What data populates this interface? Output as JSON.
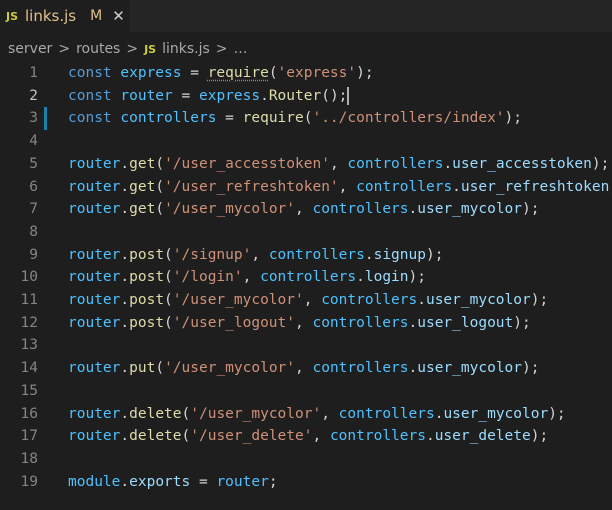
{
  "tab": {
    "icon": "js-file-icon",
    "icon_text": "JS",
    "filename": "links.js",
    "modified": "M",
    "close": "✕"
  },
  "breadcrumb": {
    "folder1": "server",
    "folder2": "routes",
    "file_icon_text": "JS",
    "file": "links.js",
    "more": "…",
    "separator": ">"
  },
  "colors": {
    "background": "#1e1e1e",
    "keyword": "#569cd6",
    "variable": "#4fc1ff",
    "property": "#9cdcfe",
    "function": "#dcdcaa",
    "string": "#ce9178",
    "punct": "#d4d4d4",
    "line_number": "#858585"
  },
  "editor": {
    "active_line": 2,
    "lines": [
      {
        "n": "1",
        "tokens": [
          [
            "const",
            "keyword"
          ],
          [
            " ",
            "punct"
          ],
          [
            "express",
            "variable"
          ],
          [
            " = ",
            "punct"
          ],
          [
            "require",
            "function"
          ],
          [
            "(",
            "punct"
          ],
          [
            "'express'",
            "string"
          ],
          [
            ");",
            "punct"
          ]
        ]
      },
      {
        "n": "2",
        "tokens": [
          [
            "const",
            "keyword"
          ],
          [
            " ",
            "punct"
          ],
          [
            "router",
            "variable"
          ],
          [
            " = ",
            "punct"
          ],
          [
            "express",
            "variable"
          ],
          [
            ".",
            "punct"
          ],
          [
            "Router",
            "function"
          ],
          [
            "();",
            "punct"
          ]
        ]
      },
      {
        "n": "3",
        "tokens": [
          [
            "const",
            "keyword"
          ],
          [
            " ",
            "punct"
          ],
          [
            "controllers",
            "variable"
          ],
          [
            " = ",
            "punct"
          ],
          [
            "require",
            "function"
          ],
          [
            "(",
            "punct"
          ],
          [
            "'../controllers/index'",
            "string"
          ],
          [
            ");",
            "punct"
          ]
        ]
      },
      {
        "n": "4",
        "tokens": []
      },
      {
        "n": "5",
        "tokens": [
          [
            "router",
            "variable"
          ],
          [
            ".",
            "punct"
          ],
          [
            "get",
            "function"
          ],
          [
            "(",
            "punct"
          ],
          [
            "'/user_accesstoken'",
            "string"
          ],
          [
            ", ",
            "punct"
          ],
          [
            "controllers",
            "variable"
          ],
          [
            ".",
            "punct"
          ],
          [
            "user_accesstoken",
            "property"
          ],
          [
            ");",
            "punct"
          ]
        ]
      },
      {
        "n": "6",
        "tokens": [
          [
            "router",
            "variable"
          ],
          [
            ".",
            "punct"
          ],
          [
            "get",
            "function"
          ],
          [
            "(",
            "punct"
          ],
          [
            "'/user_refreshtoken'",
            "string"
          ],
          [
            ", ",
            "punct"
          ],
          [
            "controllers",
            "variable"
          ],
          [
            ".",
            "punct"
          ],
          [
            "user_refreshtoken",
            "property"
          ],
          [
            ");",
            "punct"
          ]
        ]
      },
      {
        "n": "7",
        "tokens": [
          [
            "router",
            "variable"
          ],
          [
            ".",
            "punct"
          ],
          [
            "get",
            "function"
          ],
          [
            "(",
            "punct"
          ],
          [
            "'/user_mycolor'",
            "string"
          ],
          [
            ", ",
            "punct"
          ],
          [
            "controllers",
            "variable"
          ],
          [
            ".",
            "punct"
          ],
          [
            "user_mycolor",
            "property"
          ],
          [
            ");",
            "punct"
          ]
        ]
      },
      {
        "n": "8",
        "tokens": []
      },
      {
        "n": "9",
        "tokens": [
          [
            "router",
            "variable"
          ],
          [
            ".",
            "punct"
          ],
          [
            "post",
            "function"
          ],
          [
            "(",
            "punct"
          ],
          [
            "'/signup'",
            "string"
          ],
          [
            ", ",
            "punct"
          ],
          [
            "controllers",
            "variable"
          ],
          [
            ".",
            "punct"
          ],
          [
            "signup",
            "property"
          ],
          [
            ");",
            "punct"
          ]
        ]
      },
      {
        "n": "10",
        "tokens": [
          [
            "router",
            "variable"
          ],
          [
            ".",
            "punct"
          ],
          [
            "post",
            "function"
          ],
          [
            "(",
            "punct"
          ],
          [
            "'/login'",
            "string"
          ],
          [
            ", ",
            "punct"
          ],
          [
            "controllers",
            "variable"
          ],
          [
            ".",
            "punct"
          ],
          [
            "login",
            "property"
          ],
          [
            ");",
            "punct"
          ]
        ]
      },
      {
        "n": "11",
        "tokens": [
          [
            "router",
            "variable"
          ],
          [
            ".",
            "punct"
          ],
          [
            "post",
            "function"
          ],
          [
            "(",
            "punct"
          ],
          [
            "'/user_mycolor'",
            "string"
          ],
          [
            ", ",
            "punct"
          ],
          [
            "controllers",
            "variable"
          ],
          [
            ".",
            "punct"
          ],
          [
            "user_mycolor",
            "property"
          ],
          [
            ");",
            "punct"
          ]
        ]
      },
      {
        "n": "12",
        "tokens": [
          [
            "router",
            "variable"
          ],
          [
            ".",
            "punct"
          ],
          [
            "post",
            "function"
          ],
          [
            "(",
            "punct"
          ],
          [
            "'/user_logout'",
            "string"
          ],
          [
            ", ",
            "punct"
          ],
          [
            "controllers",
            "variable"
          ],
          [
            ".",
            "punct"
          ],
          [
            "user_logout",
            "property"
          ],
          [
            ");",
            "punct"
          ]
        ]
      },
      {
        "n": "13",
        "tokens": []
      },
      {
        "n": "14",
        "tokens": [
          [
            "router",
            "variable"
          ],
          [
            ".",
            "punct"
          ],
          [
            "put",
            "function"
          ],
          [
            "(",
            "punct"
          ],
          [
            "'/user_mycolor'",
            "string"
          ],
          [
            ", ",
            "punct"
          ],
          [
            "controllers",
            "variable"
          ],
          [
            ".",
            "punct"
          ],
          [
            "user_mycolor",
            "property"
          ],
          [
            ");",
            "punct"
          ]
        ]
      },
      {
        "n": "15",
        "tokens": []
      },
      {
        "n": "16",
        "tokens": [
          [
            "router",
            "variable"
          ],
          [
            ".",
            "punct"
          ],
          [
            "delete",
            "function"
          ],
          [
            "(",
            "punct"
          ],
          [
            "'/user_mycolor'",
            "string"
          ],
          [
            ", ",
            "punct"
          ],
          [
            "controllers",
            "variable"
          ],
          [
            ".",
            "punct"
          ],
          [
            "user_mycolor",
            "property"
          ],
          [
            ");",
            "punct"
          ]
        ]
      },
      {
        "n": "17",
        "tokens": [
          [
            "router",
            "variable"
          ],
          [
            ".",
            "punct"
          ],
          [
            "delete",
            "function"
          ],
          [
            "(",
            "punct"
          ],
          [
            "'/user_delete'",
            "string"
          ],
          [
            ", ",
            "punct"
          ],
          [
            "controllers",
            "variable"
          ],
          [
            ".",
            "punct"
          ],
          [
            "user_delete",
            "property"
          ],
          [
            ");",
            "punct"
          ]
        ]
      },
      {
        "n": "18",
        "tokens": []
      },
      {
        "n": "19",
        "tokens": [
          [
            "module",
            "variable"
          ],
          [
            ".",
            "punct"
          ],
          [
            "exports",
            "property"
          ],
          [
            " = ",
            "punct"
          ],
          [
            "router",
            "variable"
          ],
          [
            ";",
            "punct"
          ]
        ]
      }
    ]
  }
}
